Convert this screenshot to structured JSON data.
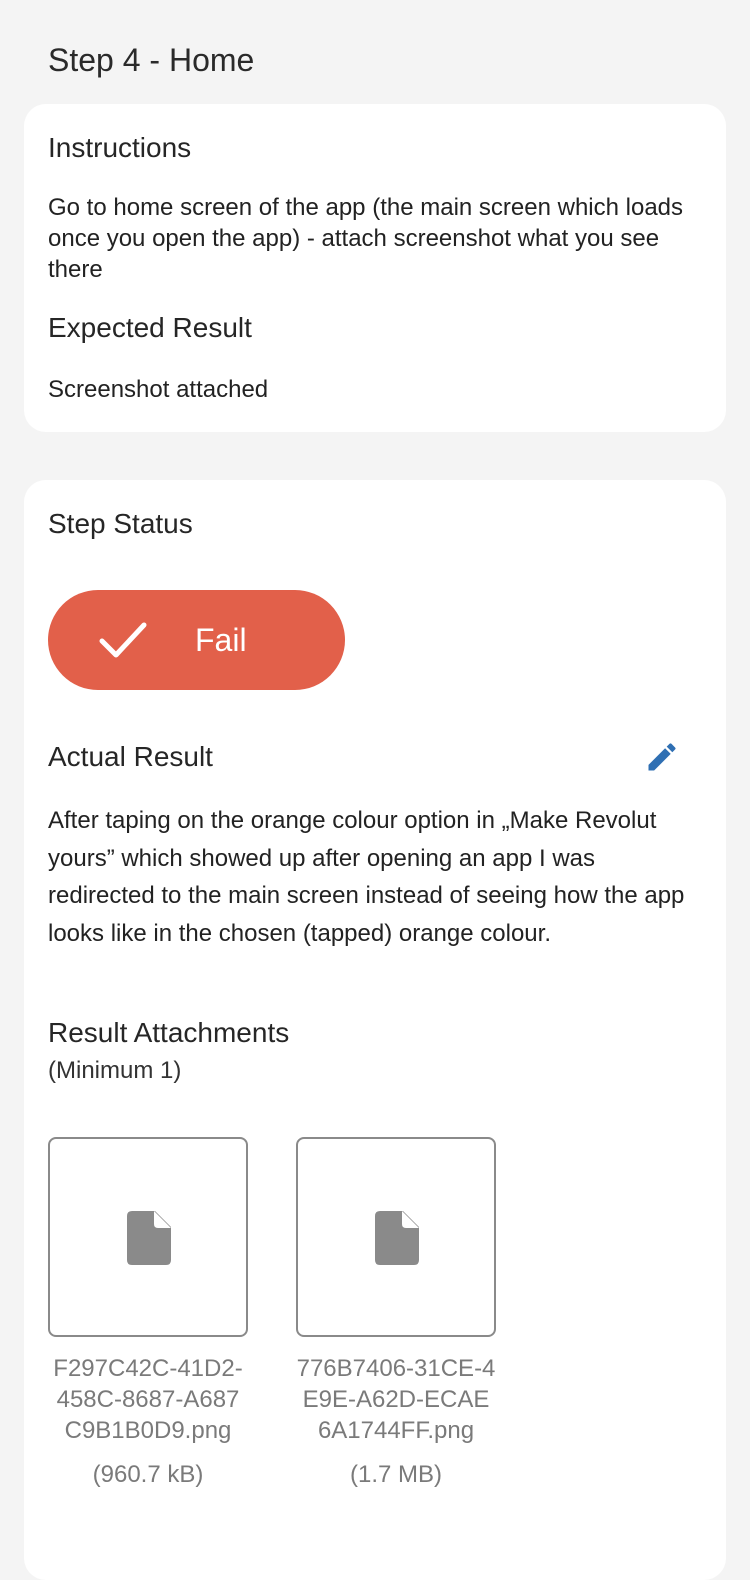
{
  "header": {
    "title": "Step 4 - Home"
  },
  "instructions_card": {
    "heading": "Instructions",
    "text": "Go to home screen of the app (the main screen which loads once you open the app) - attach screenshot what you see there",
    "expected_heading": "Expected Result",
    "expected_text": "Screenshot attached"
  },
  "status_card": {
    "heading": "Step Status",
    "status_button": {
      "label": "Fail",
      "icon": "checkmark-icon",
      "color": "#e2604a"
    },
    "actual_heading": "Actual Result",
    "edit_icon": "pencil-icon",
    "edit_icon_color": "#2f6fb3",
    "actual_text": "After taping on the orange colour option in „Make Revolut yours” which showed up after opening an app I was redirected to the main screen instead of seeing how the app looks like in the chosen (tapped) orange colour.",
    "attachments_heading": "Result Attachments",
    "attachments_sub": "(Minimum 1)",
    "attachments": [
      {
        "name": "F297C42C-41D2-458C-8687-A687C9B1B0D9.png",
        "size": "(960.7 kB)",
        "icon": "file-icon"
      },
      {
        "name": "776B7406-31CE-4E9E-A62D-ECAE6A1744FF.png",
        "size": "(1.7 MB)",
        "icon": "file-icon"
      }
    ]
  }
}
